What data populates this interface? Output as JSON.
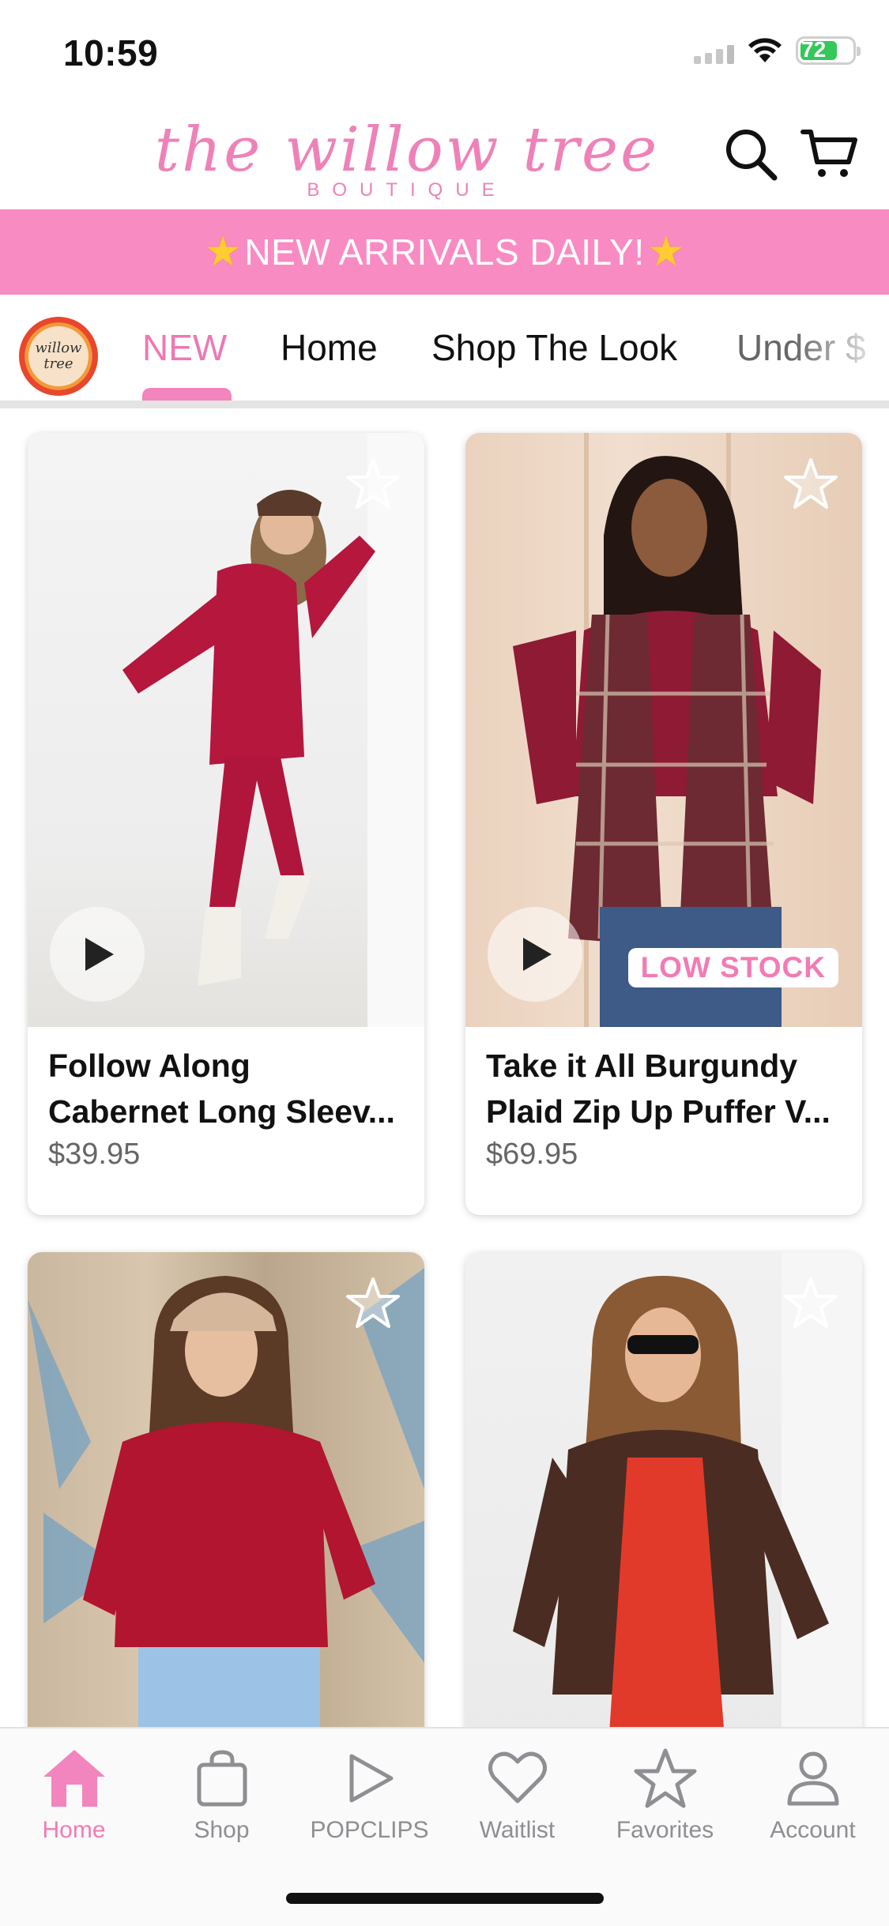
{
  "status_bar": {
    "time": "10:59",
    "battery": "72"
  },
  "header": {
    "logo_script": "the willow tree",
    "logo_sub": "BOUTIQUE"
  },
  "banner": {
    "text": "NEW ARRIVALS DAILY!"
  },
  "tabs": [
    {
      "label": "NEW",
      "active": true
    },
    {
      "label": "Home"
    },
    {
      "label": "Shop The Look"
    },
    {
      "label": "Under $"
    }
  ],
  "products": [
    {
      "title_line1": "Follow Along",
      "title_line2": "Cabernet Long Sleev...",
      "price": "$39.95",
      "has_video": true,
      "badge": ""
    },
    {
      "title_line1": "Take it All Burgundy",
      "title_line2": "Plaid Zip Up Puffer V...",
      "price": "$69.95",
      "has_video": true,
      "badge": "LOW STOCK"
    },
    {
      "title_line1": "",
      "title_line2": "",
      "price": "",
      "has_video": false,
      "badge": ""
    },
    {
      "title_line1": "",
      "title_line2": "",
      "price": "",
      "has_video": false,
      "badge": ""
    }
  ],
  "bottom_nav": [
    {
      "label": "Home",
      "icon": "home-icon",
      "active": true
    },
    {
      "label": "Shop",
      "icon": "bag-icon"
    },
    {
      "label": "POPCLIPS",
      "icon": "play-icon"
    },
    {
      "label": "Waitlist",
      "icon": "heart-icon"
    },
    {
      "label": "Favorites",
      "icon": "star-icon"
    },
    {
      "label": "Account",
      "icon": "person-icon"
    }
  ],
  "colors": {
    "brand_pink": "#f98bc3",
    "active_pink": "#f27bb5",
    "badge_pink": "#f27bb5"
  }
}
